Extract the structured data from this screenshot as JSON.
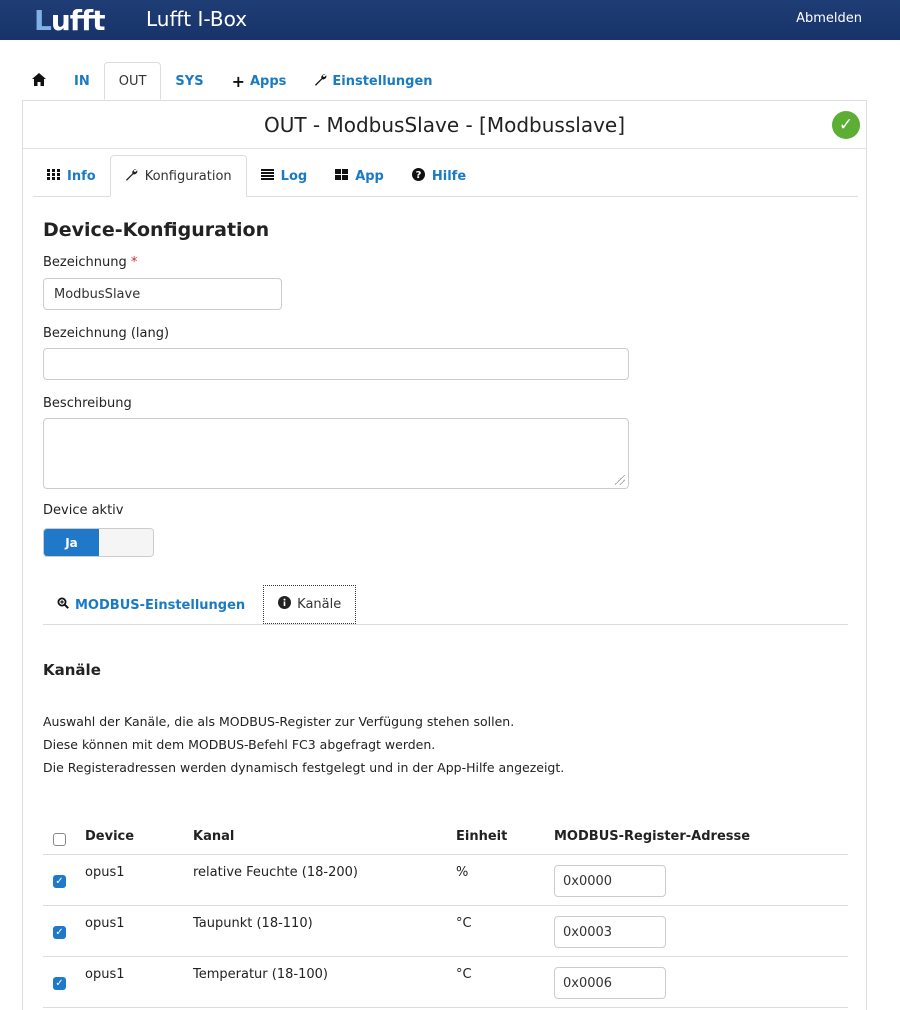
{
  "header": {
    "logo_first": "L",
    "logo_rest": "ufft",
    "app_title": "Lufft I-Box",
    "logout_label": "Abmelden"
  },
  "main_tabs": {
    "home_icon": "home-icon",
    "items": [
      {
        "label": "IN",
        "active": false
      },
      {
        "label": "OUT",
        "active": true
      },
      {
        "label": "SYS",
        "active": false
      },
      {
        "label": "Apps",
        "icon": "plus-icon",
        "active": false
      },
      {
        "label": "Einstellungen",
        "icon": "wrench-icon",
        "active": false
      }
    ]
  },
  "panel": {
    "title": "OUT - ModbusSlave - [Modbusslave]",
    "status_icon": "check-circle-icon",
    "status_color": "#5cae34"
  },
  "sub_tabs": [
    {
      "label": "Info",
      "icon": "grid-icon",
      "active": false
    },
    {
      "label": "Konfiguration",
      "icon": "wrench-icon",
      "active": true
    },
    {
      "label": "Log",
      "icon": "list-icon",
      "active": false
    },
    {
      "label": "App",
      "icon": "apps-icon",
      "active": false
    },
    {
      "label": "Hilfe",
      "icon": "question-icon",
      "active": false
    }
  ],
  "form": {
    "heading": "Device-Konfiguration",
    "name_label": "Bezeichnung",
    "name_required_mark": "*",
    "name_value": "ModbusSlave",
    "long_name_label": "Bezeichnung (lang)",
    "long_name_value": "",
    "description_label": "Beschreibung",
    "description_value": "",
    "active_label": "Device aktiv",
    "active_on_label": "Ja",
    "active": true
  },
  "inner_tabs": [
    {
      "label": "MODBUS-Einstellungen",
      "icon": "search-icon",
      "active": false
    },
    {
      "label": "Kanäle",
      "icon": "info-icon",
      "active": true
    }
  ],
  "channels": {
    "heading": "Kanäle",
    "description": [
      "Auswahl der Kanäle, die als MODBUS-Register zur Verfügung stehen sollen.",
      "Diese können mit dem MODBUS-Befehl FC3 abgefragt werden.",
      "Die Registeradressen werden dynamisch festgelegt und in der App-Hilfe angezeigt."
    ],
    "columns": [
      "Device",
      "Kanal",
      "Einheit",
      "MODBUS-Register-Adresse"
    ],
    "select_all_checked": false,
    "rows": [
      {
        "checked": true,
        "device": "opus1",
        "channel": "relative Feuchte (18-200)",
        "unit": "%",
        "address": "0x0000"
      },
      {
        "checked": true,
        "device": "opus1",
        "channel": "Taupunkt (18-110)",
        "unit": "°C",
        "address": "0x0003"
      },
      {
        "checked": true,
        "device": "opus1",
        "channel": "Temperatur (18-100)",
        "unit": "°C",
        "address": "0x0006"
      }
    ]
  }
}
